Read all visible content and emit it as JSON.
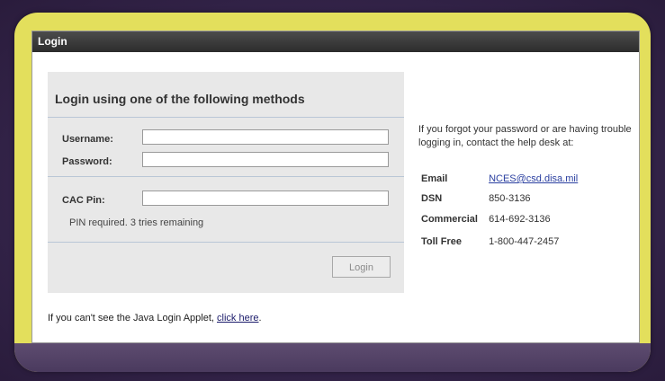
{
  "window": {
    "title": "Login"
  },
  "login_panel": {
    "heading": "Login using one of the following methods",
    "username_label": "Username:",
    "username_value": "",
    "password_label": "Password:",
    "password_value": "",
    "cac_label": "CAC Pin:",
    "cac_value": "",
    "pin_note": "PIN required. 3 tries remaining",
    "login_button": "Login"
  },
  "help": {
    "text": "If you forgot your password or are having trouble logging in, contact the help desk at:",
    "contacts": [
      {
        "label": "Email",
        "value": "NCES@csd.disa.mil"
      },
      {
        "label": "DSN",
        "value": "850-3136"
      },
      {
        "label": "Commercial",
        "value": "614-692-3136"
      },
      {
        "label": "Toll Free",
        "value": "1-800-447-2457"
      }
    ]
  },
  "footer": {
    "text": "If you can't see the Java Login Applet, ",
    "link": "click here",
    "suffix": "."
  }
}
